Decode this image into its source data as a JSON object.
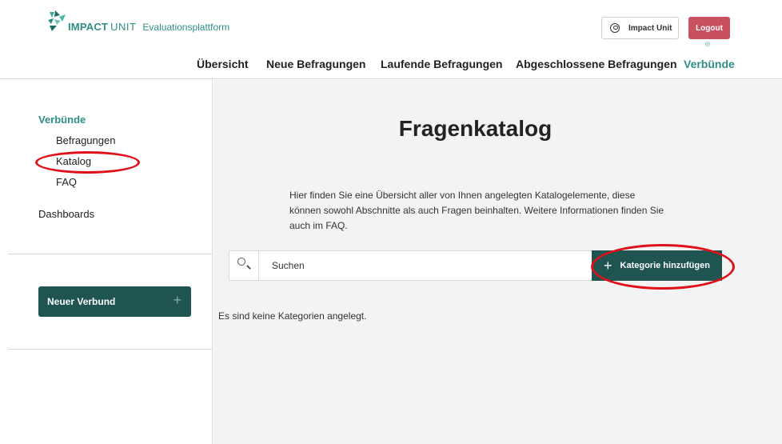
{
  "header": {
    "logo_impact": "IMPACT",
    "logo_unit": "UNIT",
    "logo_subtitle": "Evaluationsplattform",
    "user_button": "Impact Unit",
    "logout_button": "Logout"
  },
  "topnav": {
    "items": [
      {
        "label": "Übersicht"
      },
      {
        "label": "Neue Befragungen"
      },
      {
        "label": "Laufende Befragungen"
      },
      {
        "label": "Abgeschlossene Befragungen"
      },
      {
        "label": "Verbünde"
      }
    ],
    "active": "Verbünde"
  },
  "sidebar": {
    "heading": "Verbünde",
    "items": [
      {
        "label": "Befragungen"
      },
      {
        "label": "Katalog"
      },
      {
        "label": "FAQ"
      }
    ],
    "dashboards": "Dashboards",
    "new_button": "Neuer Verbund",
    "new_button_icon": "+"
  },
  "main": {
    "title": "Fragenkatalog",
    "description": "Hier finden Sie eine Übersicht aller von Ihnen angelegten Katalogelemente, diese können sowohl Abschnitte als auch Fragen beinhalten. Weitere Informationen finden Sie auch im FAQ.",
    "search_placeholder": "Suchen",
    "add_button": "Kategorie hinzufügen",
    "add_button_icon": "+",
    "empty_text": "Es sind keine Kategorien angelegt."
  },
  "colors": {
    "accent": "#2f8f86",
    "dark_button": "#1f5451",
    "logout": "#c8505f",
    "highlight_ring": "#e0101a",
    "main_bg": "#f3f3f3"
  }
}
